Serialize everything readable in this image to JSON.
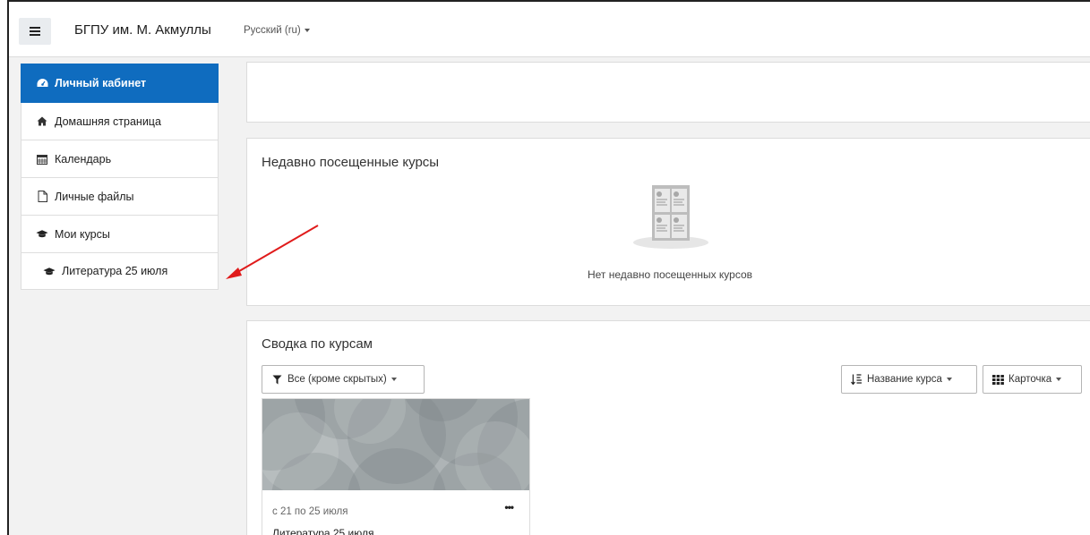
{
  "navbar": {
    "site_name": "БГПУ им. М. Акмуллы",
    "language": "Русский (ru)"
  },
  "sidebar": {
    "items": [
      {
        "label": "Личный кабинет",
        "icon": "dashboard-icon",
        "active": true
      },
      {
        "label": "Домашняя страница",
        "icon": "home-icon"
      },
      {
        "label": "Календарь",
        "icon": "calendar-icon"
      },
      {
        "label": "Личные файлы",
        "icon": "file-icon"
      },
      {
        "label": "Мои курсы",
        "icon": "graduation-cap-icon"
      },
      {
        "label": "Литература 25 июля",
        "icon": "graduation-cap-icon",
        "sub": true
      }
    ]
  },
  "recent": {
    "title": "Недавно посещенные курсы",
    "empty_text": "Нет недавно посещенных курсов"
  },
  "overview": {
    "title": "Сводка по курсам",
    "filter_label": "Все (кроме скрытых)",
    "sort_label": "Название курса",
    "view_label": "Карточка",
    "course": {
      "dates": "с 21 по 25 июля",
      "name": "Литература 25 июля",
      "menu": "•••"
    }
  },
  "colors": {
    "accent": "#0f6cbf",
    "annotation_arrow": "#e01b1b"
  }
}
